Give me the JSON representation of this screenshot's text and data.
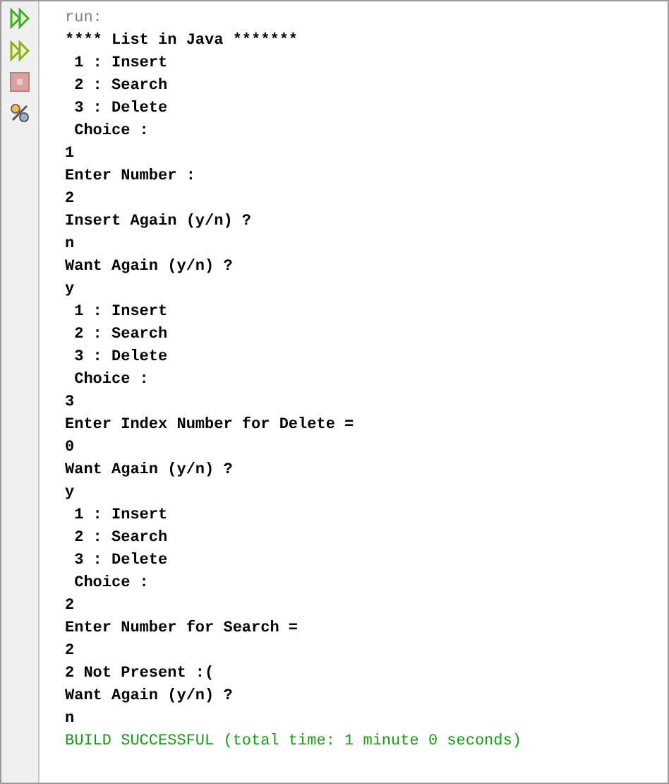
{
  "toolbar": [
    {
      "kind": "rerun"
    },
    {
      "kind": "rerun-alt"
    },
    {
      "kind": "stop",
      "disabled": true
    },
    {
      "kind": "settings"
    }
  ],
  "lines": [
    {
      "kind": "command",
      "text": "run:"
    },
    {
      "kind": "output",
      "text": "**** List in Java *******"
    },
    {
      "kind": "output",
      "text": " 1 : Insert"
    },
    {
      "kind": "output",
      "text": " 2 : Search"
    },
    {
      "kind": "output",
      "text": " 3 : Delete"
    },
    {
      "kind": "output",
      "text": " Choice :"
    },
    {
      "kind": "output",
      "text": "1"
    },
    {
      "kind": "output",
      "text": "Enter Number :"
    },
    {
      "kind": "output",
      "text": "2"
    },
    {
      "kind": "output",
      "text": "Insert Again (y/n) ?"
    },
    {
      "kind": "output",
      "text": "n"
    },
    {
      "kind": "output",
      "text": "Want Again (y/n) ?"
    },
    {
      "kind": "output",
      "text": "y"
    },
    {
      "kind": "output",
      "text": " 1 : Insert"
    },
    {
      "kind": "output",
      "text": " 2 : Search"
    },
    {
      "kind": "output",
      "text": " 3 : Delete"
    },
    {
      "kind": "output",
      "text": " Choice :"
    },
    {
      "kind": "output",
      "text": "3"
    },
    {
      "kind": "output",
      "text": "Enter Index Number for Delete ="
    },
    {
      "kind": "output",
      "text": "0"
    },
    {
      "kind": "output",
      "text": "Want Again (y/n) ?"
    },
    {
      "kind": "output",
      "text": "y"
    },
    {
      "kind": "output",
      "text": " 1 : Insert"
    },
    {
      "kind": "output",
      "text": " 2 : Search"
    },
    {
      "kind": "output",
      "text": " 3 : Delete"
    },
    {
      "kind": "output",
      "text": " Choice :"
    },
    {
      "kind": "output",
      "text": "2"
    },
    {
      "kind": "output",
      "text": "Enter Number for Search ="
    },
    {
      "kind": "output",
      "text": "2"
    },
    {
      "kind": "output",
      "text": "2 Not Present :("
    },
    {
      "kind": "output",
      "text": "Want Again (y/n) ?"
    },
    {
      "kind": "output",
      "text": "n"
    },
    {
      "kind": "success",
      "text": "BUILD SUCCESSFUL (total time: 1 minute 0 seconds)"
    }
  ]
}
